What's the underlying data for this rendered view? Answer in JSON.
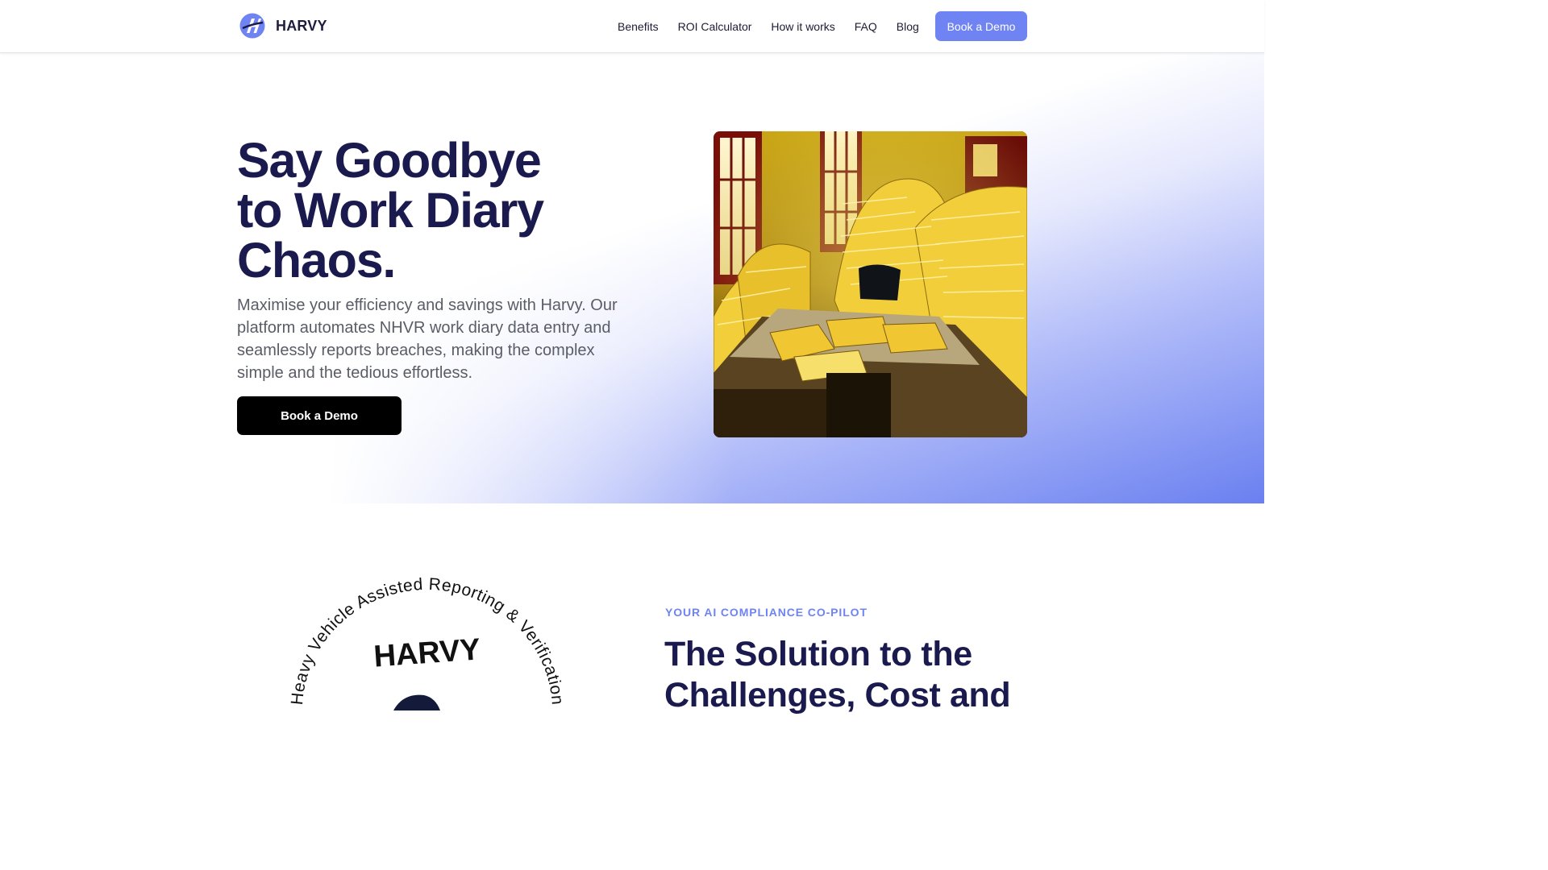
{
  "brand": {
    "name": "HARVY",
    "accent": "#6f84f2",
    "navy": "#1b1a4e"
  },
  "nav": {
    "items": [
      "Benefits",
      "ROI Calculator",
      "How it works",
      "FAQ",
      "Blog"
    ],
    "cta": "Book a Demo"
  },
  "hero": {
    "title_lines": [
      "Say Goodbye",
      "to Work Diary",
      "Chaos."
    ],
    "subtitle": "Maximise your efficiency and savings with Harvy. Our platform automates NHVR work diary data entry and seamlessly reports breaches, making the complex simple and the tedious effortless.",
    "cta": "Book a Demo"
  },
  "solution": {
    "badge_arc_text": "Heavy Vehicle Assisted Reporting & Verification",
    "badge_wordmark": "HARVY",
    "eyebrow": "YOUR AI COMPLIANCE CO-PILOT",
    "title": "The Solution to the Challenges, Cost and"
  }
}
